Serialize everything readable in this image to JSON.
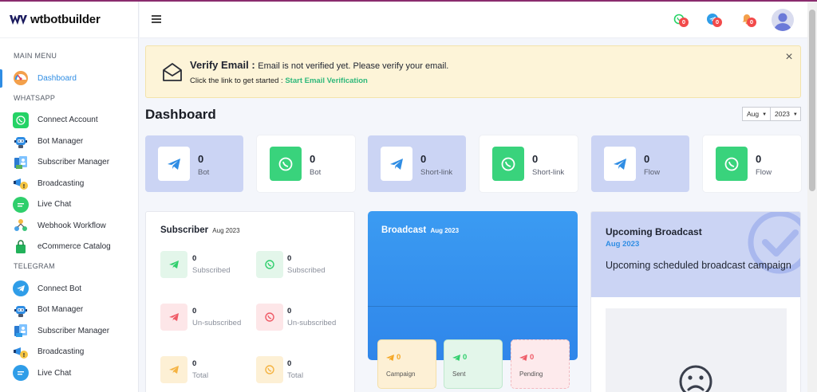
{
  "brand": {
    "name": "wtbotbuilder"
  },
  "sidebar": {
    "sections": {
      "main": "MAIN MENU",
      "whatsapp": "WHATSAPP",
      "telegram": "TELEGRAM"
    },
    "main_items": [
      {
        "label": "Dashboard",
        "icon": "speedometer-icon",
        "active": true
      }
    ],
    "whatsapp_items": [
      {
        "label": "Connect Account",
        "icon": "whatsapp-icon"
      },
      {
        "label": "Bot Manager",
        "icon": "robot-icon"
      },
      {
        "label": "Subscriber Manager",
        "icon": "subscriber-icon"
      },
      {
        "label": "Broadcasting",
        "icon": "megaphone-icon"
      },
      {
        "label": "Live Chat",
        "icon": "chat-icon"
      },
      {
        "label": "Webhook Workflow",
        "icon": "webhook-icon"
      },
      {
        "label": "eCommerce Catalog",
        "icon": "shopping-bag-icon"
      }
    ],
    "telegram_items": [
      {
        "label": "Connect Bot",
        "icon": "telegram-icon"
      },
      {
        "label": "Bot Manager",
        "icon": "robot-icon"
      },
      {
        "label": "Subscriber Manager",
        "icon": "subscriber-icon"
      },
      {
        "label": "Broadcasting",
        "icon": "megaphone-icon"
      },
      {
        "label": "Live Chat",
        "icon": "chat-icon"
      }
    ]
  },
  "header": {
    "notifications": [
      {
        "icon": "whatsapp-icon",
        "count": "0"
      },
      {
        "icon": "telegram-icon",
        "count": "0"
      },
      {
        "icon": "bell-icon",
        "count": "0"
      }
    ]
  },
  "alert": {
    "title": "Verify Email :",
    "message": "Email is not verified yet. Please verify your email.",
    "prompt": "Click the link to get started :",
    "link": "Start Email Verification"
  },
  "dashboard": {
    "title": "Dashboard",
    "month": "Aug",
    "year": "2023"
  },
  "stats": [
    {
      "value": "0",
      "label": "Bot",
      "icon": "telegram-icon"
    },
    {
      "value": "0",
      "label": "Bot",
      "icon": "whatsapp-icon"
    },
    {
      "value": "0",
      "label": "Short-link",
      "icon": "telegram-icon"
    },
    {
      "value": "0",
      "label": "Short-link",
      "icon": "whatsapp-icon"
    },
    {
      "value": "0",
      "label": "Flow",
      "icon": "telegram-icon"
    },
    {
      "value": "0",
      "label": "Flow",
      "icon": "whatsapp-icon"
    }
  ],
  "subscriber": {
    "title": "Subscriber",
    "period": "Aug 2023",
    "telegram": [
      {
        "value": "0",
        "label": "Subscribed"
      },
      {
        "value": "0",
        "label": "Un-subscribed"
      },
      {
        "value": "0",
        "label": "Total"
      }
    ],
    "whatsapp": [
      {
        "value": "0",
        "label": "Subscribed"
      },
      {
        "value": "0",
        "label": "Un-subscribed"
      },
      {
        "value": "0",
        "label": "Total"
      }
    ]
  },
  "broadcast": {
    "title": "Broadcast",
    "period": "Aug 2023",
    "tiles": [
      {
        "value": "0",
        "label": "Campaign"
      },
      {
        "value": "0",
        "label": "Sent"
      },
      {
        "value": "0",
        "label": "Pending"
      }
    ]
  },
  "upcoming": {
    "title": "Upcoming Broadcast",
    "period": "Aug 2023",
    "description": "Upcoming scheduled broadcast campaign"
  },
  "colors": {
    "accent": "#2f8de4",
    "green": "#39d37c",
    "lavender": "#cbd4f4",
    "alert_bg": "#fdf4d8",
    "badge": "#f24a4a"
  }
}
